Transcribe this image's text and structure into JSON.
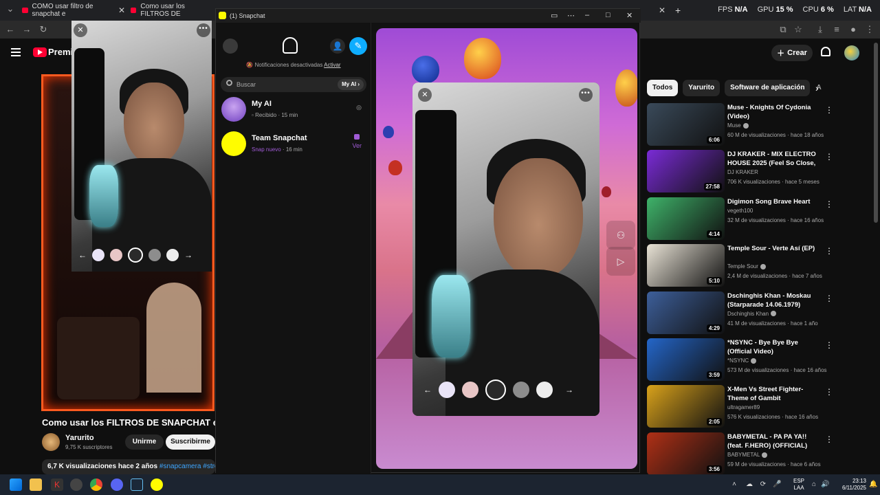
{
  "browser": {
    "tabs": [
      {
        "title": "COMO usar filtro de snapchat e"
      },
      {
        "title": "Como usar los FILTROS DE"
      }
    ],
    "stats": [
      {
        "label": "FPS",
        "value": "N/A"
      },
      {
        "label": "GPU",
        "value": "15 %"
      },
      {
        "label": "CPU",
        "value": "6 %"
      },
      {
        "label": "LAT",
        "value": "N/A"
      }
    ]
  },
  "youtube": {
    "logo_word": "Premiu",
    "create_label": "Crear",
    "video_title": "Como usar los FILTROS DE SNAPCHAT en",
    "channel_name": "Yarurito",
    "channel_subs": "9,75 K suscriptores",
    "join_label": "Unirme",
    "subscribe_label": "Suscribirme",
    "views": "6,7 K visualizaciones",
    "age": "hace 2 años",
    "tags": "#snapcamera #stream",
    "chips": [
      "Todos",
      "Yarurito",
      "Software de aplicación",
      "A"
    ],
    "recommendations": [
      {
        "title": "Muse - Knights Of Cydonia (Video)",
        "author": "Muse",
        "meta": "60 M de visualizaciones · hace 18 años",
        "duration": "6:06",
        "verified": true,
        "thumb_color": "#3a4a5a"
      },
      {
        "title": "DJ KRAKER - MIX ELECTRO HOUSE 2025 (Feel So Close, ...",
        "author": "DJ KRAKER",
        "meta": "706 K visualizaciones · hace 5 meses",
        "duration": "27:58",
        "verified": false,
        "thumb_color": "#7a2bd6"
      },
      {
        "title": "Digimon Song Brave Heart",
        "author": "vegeth100",
        "meta": "32 M de visualizaciones · hace 16 años",
        "duration": "4:14",
        "verified": false,
        "thumb_color": "#3fb36a"
      },
      {
        "title": "Temple Sour - Verte Así (EP)",
        "author": "Temple Sour",
        "meta": "2,4 M de visualizaciones · hace 7 años",
        "duration": "5:10",
        "verified": true,
        "thumb_color": "#e9e3d6"
      },
      {
        "title": "Dschinghis Khan - Moskau (Starparade 14.06.1979)",
        "author": "Dschinghis Khan",
        "meta": "41 M de visualizaciones · hace 1 año",
        "duration": "4:29",
        "verified": true,
        "thumb_color": "#3d5f9a"
      },
      {
        "title": "*NSYNC - Bye Bye Bye (Official Video)",
        "author": "*NSYNC",
        "meta": "573 M de visualizaciones · hace 16 años",
        "duration": "3:59",
        "verified": true,
        "thumb_color": "#2466c9"
      },
      {
        "title": "X-Men Vs Street Fighter-Theme of Gambit",
        "author": "ultragamer89",
        "meta": "576 K visualizaciones · hace 16 años",
        "duration": "2:05",
        "verified": false,
        "thumb_color": "#d9a21b"
      },
      {
        "title": "BABYMETAL - PA PA YA!! (feat. F.HERO) (OFFICIAL)",
        "author": "BABYMETAL",
        "meta": "59 M de visualizaciones · hace 6 años",
        "duration": "3:56",
        "verified": true,
        "thumb_color": "#b03016"
      }
    ]
  },
  "snapchat": {
    "window_title": "(1) Snapchat",
    "notifications_text": "Notificaciones desactivadas",
    "notifications_action": "Activar",
    "search_placeholder": "Buscar",
    "myai_chip": "My AI",
    "chats": [
      {
        "name": "My AI",
        "status": "Recibido",
        "time": "15 min",
        "right": "",
        "status_color": "#aaaaaa"
      },
      {
        "name": "Team Snapchat",
        "status": "Snap nuevo",
        "time": "16 min",
        "right": "Ver",
        "status_color": "#a05bd6"
      }
    ]
  },
  "taskbar": {
    "lang_top": "ESP",
    "lang_bottom": "LAA",
    "time": "23:13",
    "date": "6/11/2025"
  }
}
